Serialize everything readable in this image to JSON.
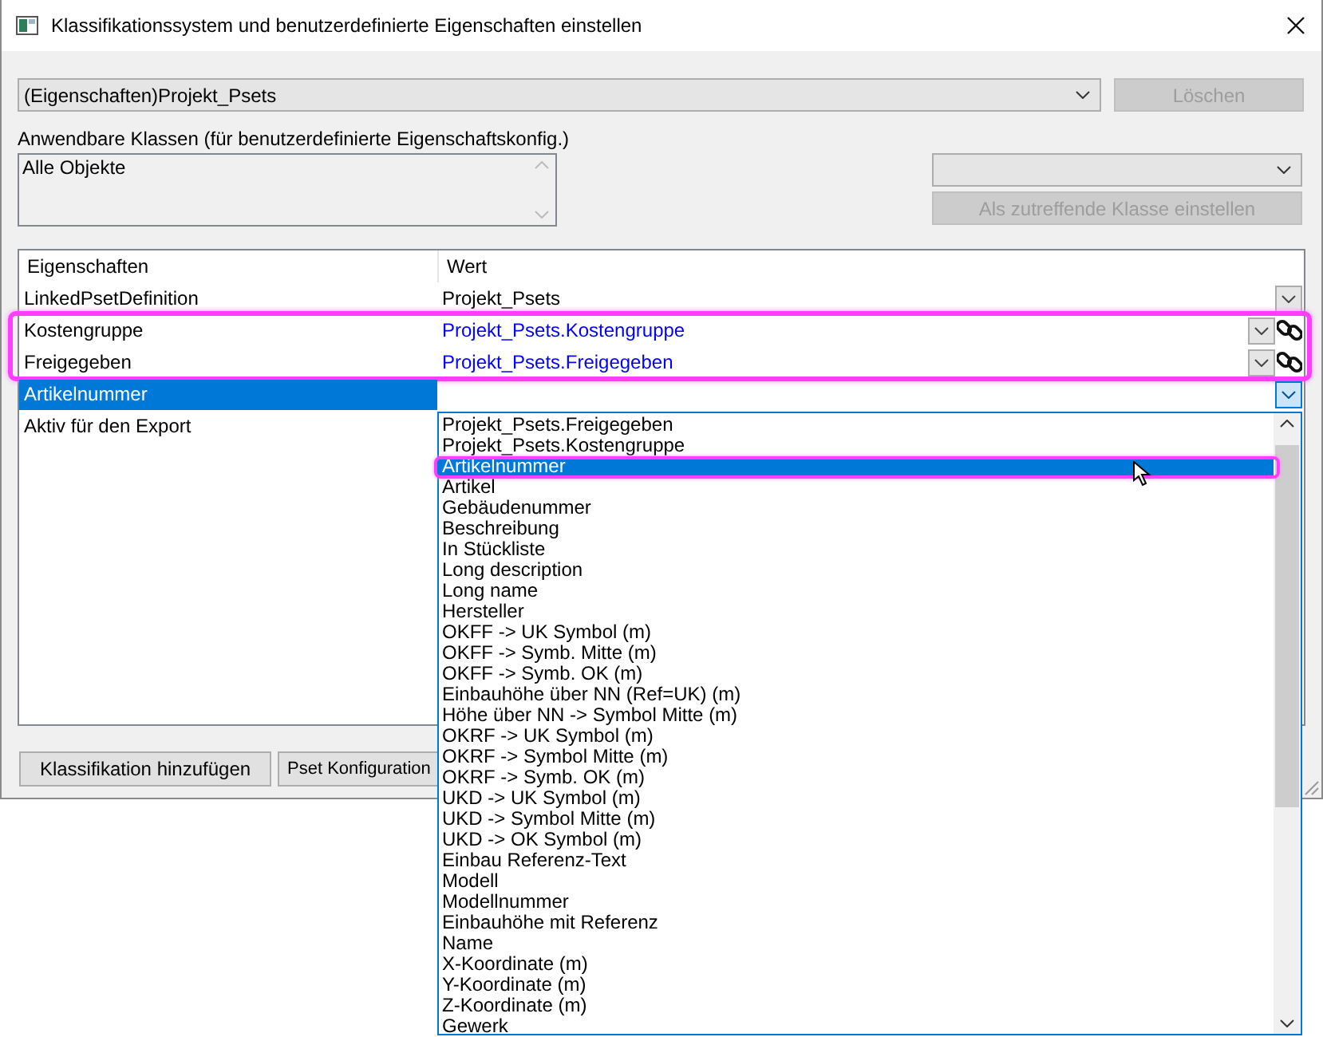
{
  "window": {
    "title": "Klassifikationssystem und benutzerdefinierte Eigenschaften einstellen"
  },
  "pset_combo": {
    "value": "(Eigenschaften)Projekt_Psets"
  },
  "delete_button": {
    "label": "Löschen",
    "disabled": true
  },
  "classes_label": "Anwendbare Klassen (für benutzerdefinierte Eigenschaftskonfig.)",
  "classes_list": {
    "items": [
      "Alle Objekte"
    ]
  },
  "set_class_button": {
    "label": "Als zutreffende Klasse einstellen",
    "disabled": true
  },
  "grid": {
    "columns": [
      "Eigenschaften",
      "Wert"
    ],
    "rows": [
      {
        "name": "LinkedPsetDefinition",
        "value": "Projekt_Psets",
        "linked": false,
        "selected": false,
        "highlighted": false,
        "dropdown": true
      },
      {
        "name": "Kostengruppe",
        "value": "Projekt_Psets.Kostengruppe",
        "linked": true,
        "selected": false,
        "highlighted": true,
        "dropdown": true
      },
      {
        "name": "Freigegeben",
        "value": "Projekt_Psets.Freigegeben",
        "linked": true,
        "selected": false,
        "highlighted": true,
        "dropdown": true
      },
      {
        "name": "Artikelnummer",
        "value": "",
        "linked": false,
        "selected": true,
        "highlighted": false,
        "dropdown": true
      },
      {
        "name": "Aktiv für den Export",
        "linked": false,
        "selected": false,
        "highlighted": false
      }
    ]
  },
  "buttons": [
    {
      "label": "Klassifikation hinzufügen"
    },
    {
      "label": "Pset Konfiguration"
    }
  ],
  "dropdown_list": {
    "items": [
      {
        "label": "Projekt_Psets.Freigegeben",
        "selected": false,
        "highlighted": false
      },
      {
        "label": "Projekt_Psets.Kostengruppe",
        "selected": false,
        "highlighted": false
      },
      {
        "label": "Artikelnummer",
        "selected": true,
        "highlighted": true
      },
      {
        "label": "Artikel",
        "selected": false,
        "highlighted": false
      },
      {
        "label": "Gebäudenummer",
        "selected": false,
        "highlighted": false
      },
      {
        "label": "Beschreibung",
        "selected": false,
        "highlighted": false
      },
      {
        "label": "In Stückliste",
        "selected": false,
        "highlighted": false
      },
      {
        "label": "Long description",
        "selected": false,
        "highlighted": false
      },
      {
        "label": "Long name",
        "selected": false,
        "highlighted": false
      },
      {
        "label": "Hersteller",
        "selected": false,
        "highlighted": false
      },
      {
        "label": "OKFF -> UK Symbol (m)",
        "selected": false,
        "highlighted": false
      },
      {
        "label": "OKFF -> Symb. Mitte (m)",
        "selected": false,
        "highlighted": false
      },
      {
        "label": "OKFF -> Symb. OK (m)",
        "selected": false,
        "highlighted": false
      },
      {
        "label": "Einbauhöhe über NN (Ref=UK) (m)",
        "selected": false,
        "highlighted": false
      },
      {
        "label": "Höhe über NN -> Symbol Mitte (m)",
        "selected": false,
        "highlighted": false
      },
      {
        "label": "OKRF -> UK Symbol (m)",
        "selected": false,
        "highlighted": false
      },
      {
        "label": "OKRF -> Symbol Mitte (m)",
        "selected": false,
        "highlighted": false
      },
      {
        "label": "OKRF -> Symb. OK (m)",
        "selected": false,
        "highlighted": false
      },
      {
        "label": "UKD -> UK Symbol (m)",
        "selected": false,
        "highlighted": false
      },
      {
        "label": "UKD -> Symbol Mitte (m)",
        "selected": false,
        "highlighted": false
      },
      {
        "label": "UKD -> OK Symbol (m)",
        "selected": false,
        "highlighted": false
      },
      {
        "label": "Einbau Referenz-Text",
        "selected": false,
        "highlighted": false
      },
      {
        "label": "Modell",
        "selected": false,
        "highlighted": false
      },
      {
        "label": "Modellnummer",
        "selected": false,
        "highlighted": false
      },
      {
        "label": "Einbauhöhe mit Referenz",
        "selected": false,
        "highlighted": false
      },
      {
        "label": "Name",
        "selected": false,
        "highlighted": false
      },
      {
        "label": "X-Koordinate (m)",
        "selected": false,
        "highlighted": false
      },
      {
        "label": "Y-Koordinate (m)",
        "selected": false,
        "highlighted": false
      },
      {
        "label": "Z-Koordinate (m)",
        "selected": false,
        "highlighted": false
      },
      {
        "label": "Gewerk",
        "selected": false,
        "highlighted": false
      }
    ]
  }
}
